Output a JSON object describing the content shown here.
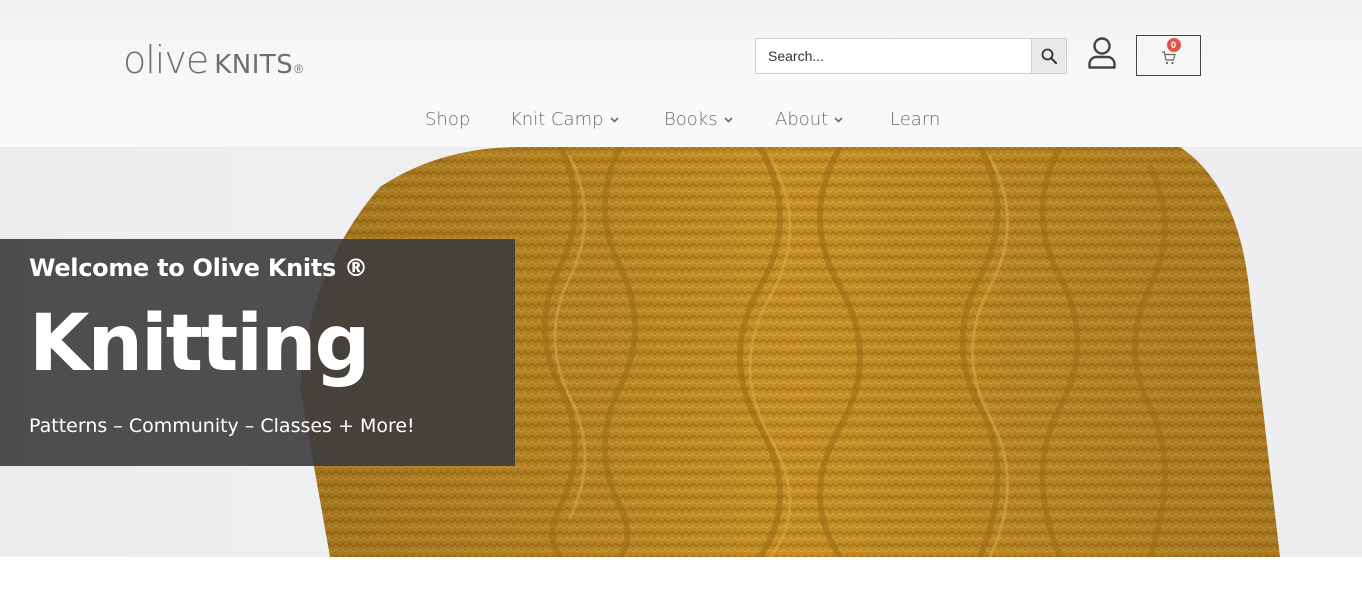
{
  "header": {
    "logo": {
      "olive": "olive",
      "knits": "KNITS",
      "reg": "®"
    },
    "search": {
      "placeholder": "Search...",
      "value": ""
    },
    "cart": {
      "count": "0"
    }
  },
  "nav": {
    "items": [
      {
        "label": "Shop",
        "has_dropdown": false
      },
      {
        "label": "Knit Camp",
        "has_dropdown": true
      },
      {
        "label": "Books",
        "has_dropdown": true
      },
      {
        "label": "About",
        "has_dropdown": true
      },
      {
        "label": "Learn",
        "has_dropdown": false
      }
    ]
  },
  "hero": {
    "welcome": "Welcome to Olive Knits ®",
    "headline": "Knitting",
    "tagline": "Patterns – Community – Classes + More!"
  },
  "colors": {
    "mustard": "#c9932a",
    "overlay": "#3c3c3e",
    "badge": "#e2564a",
    "nav_text": "#6a6a6c"
  }
}
